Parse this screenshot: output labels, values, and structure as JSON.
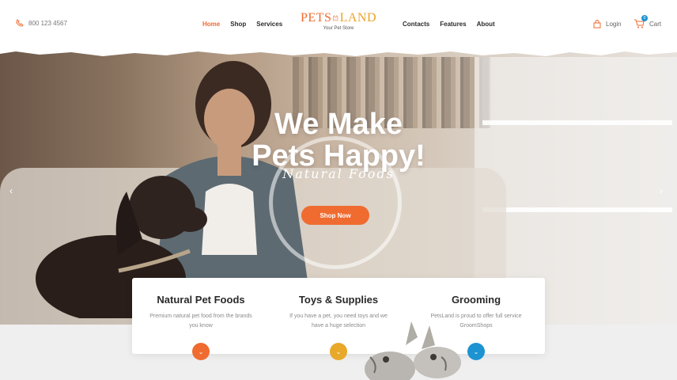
{
  "header": {
    "phone": "800 123 4567",
    "nav_left": [
      {
        "label": "Home",
        "active": true
      },
      {
        "label": "Shop"
      },
      {
        "label": "Services"
      }
    ],
    "nav_right": [
      {
        "label": "Contacts"
      },
      {
        "label": "Features"
      },
      {
        "label": "About"
      }
    ],
    "logo": {
      "part1": "PETS",
      "part2": "LAND",
      "tagline": "Your Pet Store"
    },
    "login_label": "Login",
    "cart_label": "Cart",
    "cart_count": "0"
  },
  "hero": {
    "title_line1": "We Make",
    "title_line2": "Pets Happy!",
    "script": "Natural Foods",
    "cta_label": "Shop Now"
  },
  "features": [
    {
      "title": "Natural Pet Foods",
      "text": "Premium natural pet food from the brands you know",
      "color": "#f06b30"
    },
    {
      "title": "Toys & Supplies",
      "text": "If you have a pet, you need toys and we have a huge selection",
      "color": "#e8a82a"
    },
    {
      "title": "Grooming",
      "text": "PetsLand is proud to offer full service GroomShops",
      "color": "#1d93d2"
    }
  ],
  "colors": {
    "accent": "#f06b30",
    "secondary": "#e8a82a",
    "blue": "#1d93d2"
  }
}
